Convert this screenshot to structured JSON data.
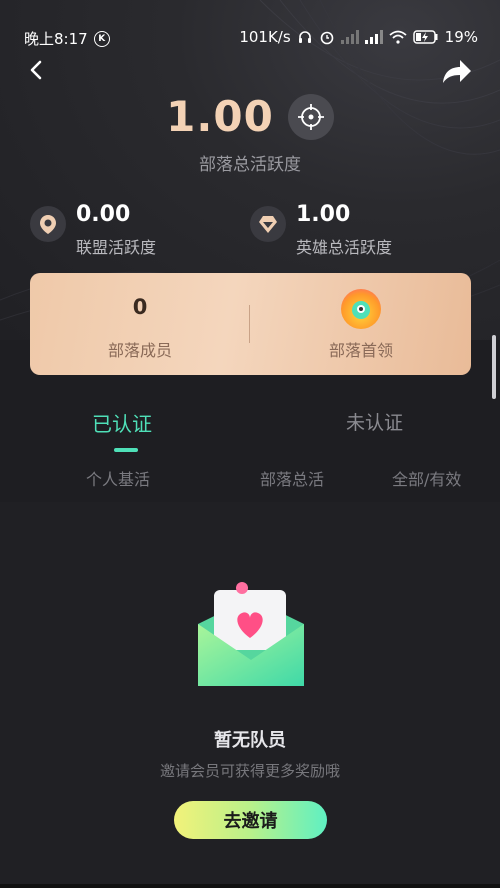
{
  "status_bar": {
    "time": "晚上8:17",
    "k_badge": "K",
    "net_speed": "101K/s",
    "battery": "19%"
  },
  "hero": {
    "total_value": "1.00",
    "total_label": "部落总活跃度",
    "alliance_value": "0.00",
    "alliance_label": "联盟活跃度",
    "hero_value": "1.00",
    "hero_label": "英雄总活跃度"
  },
  "card": {
    "members_value": "0",
    "members_label": "部落成员",
    "leader_label": "部落首领"
  },
  "tabs": {
    "verified": "已认证",
    "unverified": "未认证"
  },
  "columns": {
    "personal": "个人基活",
    "tribe_total": "部落总活",
    "all_valid": "全部/有效"
  },
  "empty": {
    "title": "暂无队员",
    "subtitle": "邀请会员可获得更多奖励哦",
    "button": "去邀请"
  },
  "colors": {
    "accent": "#4fe0b8",
    "hero_value": "#f3d2b5",
    "card_start": "#efc9a9",
    "card_end": "#e9bb98"
  },
  "icons": [
    "back-icon",
    "share-icon",
    "target-icon",
    "alliance-icon",
    "hero-icon",
    "leader-avatar-icon",
    "envelope-heart-icon"
  ]
}
